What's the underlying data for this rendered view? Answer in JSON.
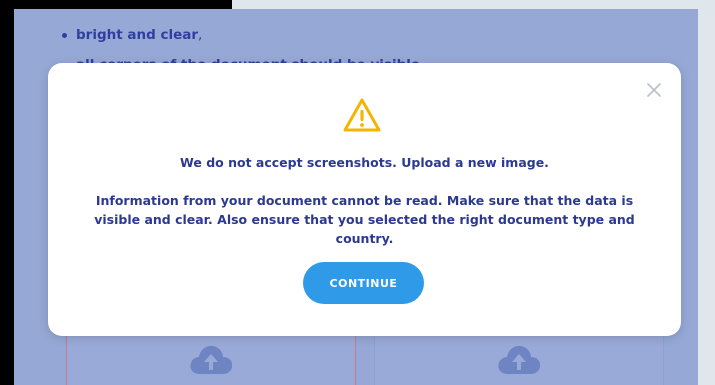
{
  "background": {
    "bullets": [
      {
        "text": "bright and clear",
        "suffix": ","
      },
      {
        "text": "all corners of the document should be visible",
        "suffix": ""
      }
    ]
  },
  "modal": {
    "heading": "We do not accept screenshots. Upload a new image.",
    "body": "Information from your document cannot be read. Make sure that the data is visible and clear. Also ensure that you selected the right document type and country.",
    "continue_label": "CONTINUE",
    "icons": {
      "warning": "warning-triangle-icon",
      "close": "close-icon",
      "upload": "cloud-upload-icon"
    }
  },
  "colors": {
    "accent": "#2f9be8",
    "text": "#2b3990",
    "warning": "#f4b400",
    "overlay": "#96a8d6"
  }
}
